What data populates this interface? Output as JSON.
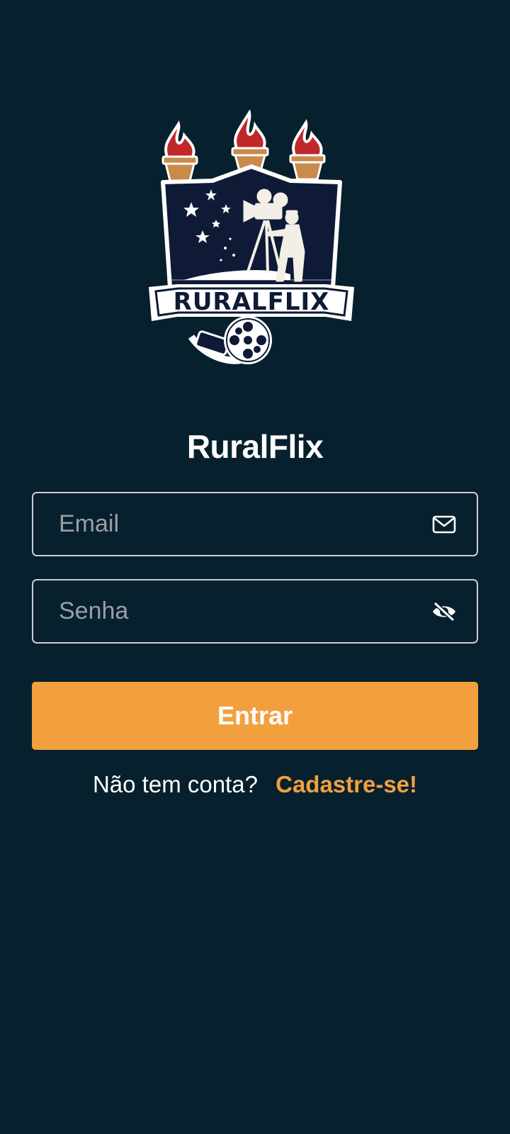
{
  "app": {
    "title": "RuralFlix",
    "logo_text": "RURALFLIX"
  },
  "login": {
    "email_placeholder": "Email",
    "email_value": "",
    "password_placeholder": "Senha",
    "password_value": "",
    "email_icon": "mail-icon",
    "password_icon": "eye-off-icon",
    "submit_label": "Entrar"
  },
  "signup": {
    "prompt": "Não tem conta?",
    "link": "Cadastre-se!"
  },
  "colors": {
    "background": "#07202d",
    "accent": "#f2a03e",
    "crest_navy": "#0e1a36",
    "flame_red": "#c0282b",
    "torch_tan": "#c98a4b"
  }
}
